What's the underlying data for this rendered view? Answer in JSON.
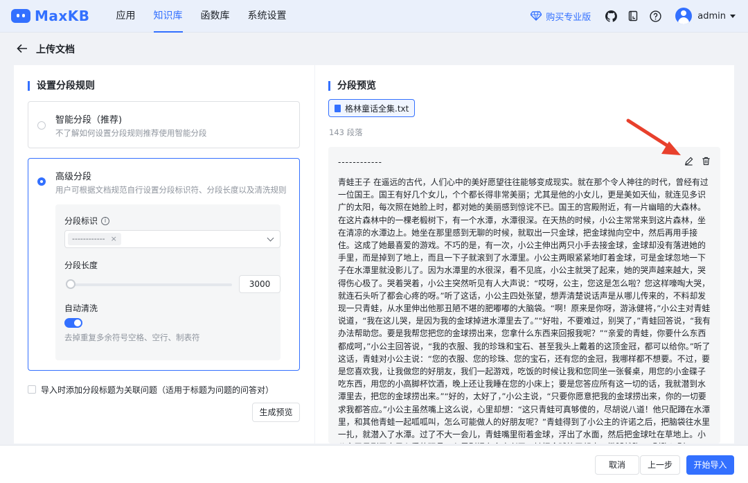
{
  "header": {
    "logo_text": "MaxKB",
    "nav": [
      {
        "label": "应用",
        "active": false
      },
      {
        "label": "知识库",
        "active": true
      },
      {
        "label": "函数库",
        "active": false
      },
      {
        "label": "系统设置",
        "active": false
      }
    ],
    "pro_label": "购买专业版",
    "user": "admin"
  },
  "page": {
    "title": "上传文档",
    "back_icon": "arrow-left-icon"
  },
  "left": {
    "section_title": "设置分段规则",
    "smart": {
      "title": "智能分段（推荐)",
      "desc": "不了解如何设置分段规则推荐使用智能分段",
      "selected": false
    },
    "advanced": {
      "title": "高级分段",
      "desc": "用户可根据文档规范自行设置分段标识符、分段长度以及清洗规则",
      "selected": true,
      "identifier_label": "分段标识",
      "identifier_tag": "------------",
      "length_label": "分段长度",
      "length_value": "3000",
      "length_fraction": 0.0,
      "clean_label": "自动清洗",
      "clean_enabled": true,
      "clean_desc": "去掉重复多余符号空格、空行、制表符"
    },
    "checkbox_label": "导入时添加分段标题为关联问题（适用于标题为问题的问答对）",
    "checkbox_checked": false,
    "preview_button": "生成预览"
  },
  "right": {
    "section_title": "分段预览",
    "file_name": "格林童话全集.txt",
    "count": "143 段落",
    "dash": "------------",
    "text": "青蛙王子 在遥远的古代，人们心中的美好愿望往往能够变成现实。就在那个令人神往的时代，曾经有过一位国王。国王有好几个女儿，个个都长得非常美丽；尤其是他的小女儿，更是美如天仙，就连见多识广的太阳，每次照在她脸上时，都对她的美丽感到惊诧不已。国王的宫殿附近，有一片幽暗的大森林。在这片森林中的一棵老椴树下，有一个水潭，水潭很深。在天热的时候，小公主常常来到这片森林，坐在清凉的水潭边上。她坐在那里感到无聊的时候，就取出一只金球，把金球抛向空中，然后再用手接住。这成了她最喜爱的游戏。不巧的是，有一次，小公主伸出两只小手去接金球，金球却没有落进她的手里，而是掉到了地上，而且一下子就滚到了水潭里。小公主两眼紧紧地盯着金球，可是金球忽地一下子在水潭里就没影儿了。因为水潭里的水很深，看不见底，小公主就哭了起来，她的哭声越来越大，哭得伤心极了。哭着哭着，小公主突然听见有人大声说：“哎呀，公主，您这是怎么啦？您这样嚎啕大哭，就连石头听了都会心疼的呀。”听了这话，小公主四处张望，想弄清楚说话声是从哪儿传来的，不料却发现一只青蛙，从水里伸出他那丑陋不堪的肥嘟嘟的大脑袋。“啊！原来是你呀，游泳健将，”小公主对青蛙说道，“我在这儿哭，是因为我的金球掉进水潭里去了。”“好啦，不要难过，别哭了，”青蛙回答说，“我有办法帮助您。要是我帮您把您的金球捞出来，您拿什么东西来回报我呢？”“亲爱的青蛙，你要什么东西都成呵，”小公主回答说，“我的衣服、我的珍珠和宝石、甚至我头上戴着的这顶金冠，都可以给你。”听了这话，青蛙对小公主说：“您的衣服、您的珍珠、您的宝石，还有您的金冠，我哪样都不想要。不过，要是您喜欢我，让我做您的好朋友，我们一起游戏，吃饭的时候让我和您同坐一张餐桌，用您的小金碟子吃东西，用您的小高脚杯饮酒，晚上还让我睡在您的小床上；要是您答应所有这一切的话，我就潜到水潭里去，把您的金球捞出来。”“好的，太好了，”小公主说，“只要你愿意把我的金球捞出来，你的一切要求我都答应。”小公主虽然嘴上这么说，心里却想：“这只青蛙可真够傻的，尽胡说八道！他只配蹲在水潭里，和其他青蛙一起呱呱叫，怎么可能做人的好朋友呢？”青蛙得到了小公主的许诺之后，把脑袋往水里一扎，就潜入了水潭。过了不大一会儿，青蛙嘴里衔着金球，浮出了水面，然后把金球吐在草地上。小公主又见到了自己心爱的玩具，心里别提有多高兴了。她把金球拣了起来，撒腿就跑。“别跑！别跑！”青蛙大声叫道，“带上我呀！我可跑不了您那么快。”尽管青蛙扯着嗓子拼命叫喊，可是没有一点儿用。小公主"
  },
  "footer": {
    "cancel": "取消",
    "prev": "上一步",
    "start": "开始导入"
  },
  "colors": {
    "accent": "#3370ff",
    "annotation_arrow": "#e8402c"
  }
}
